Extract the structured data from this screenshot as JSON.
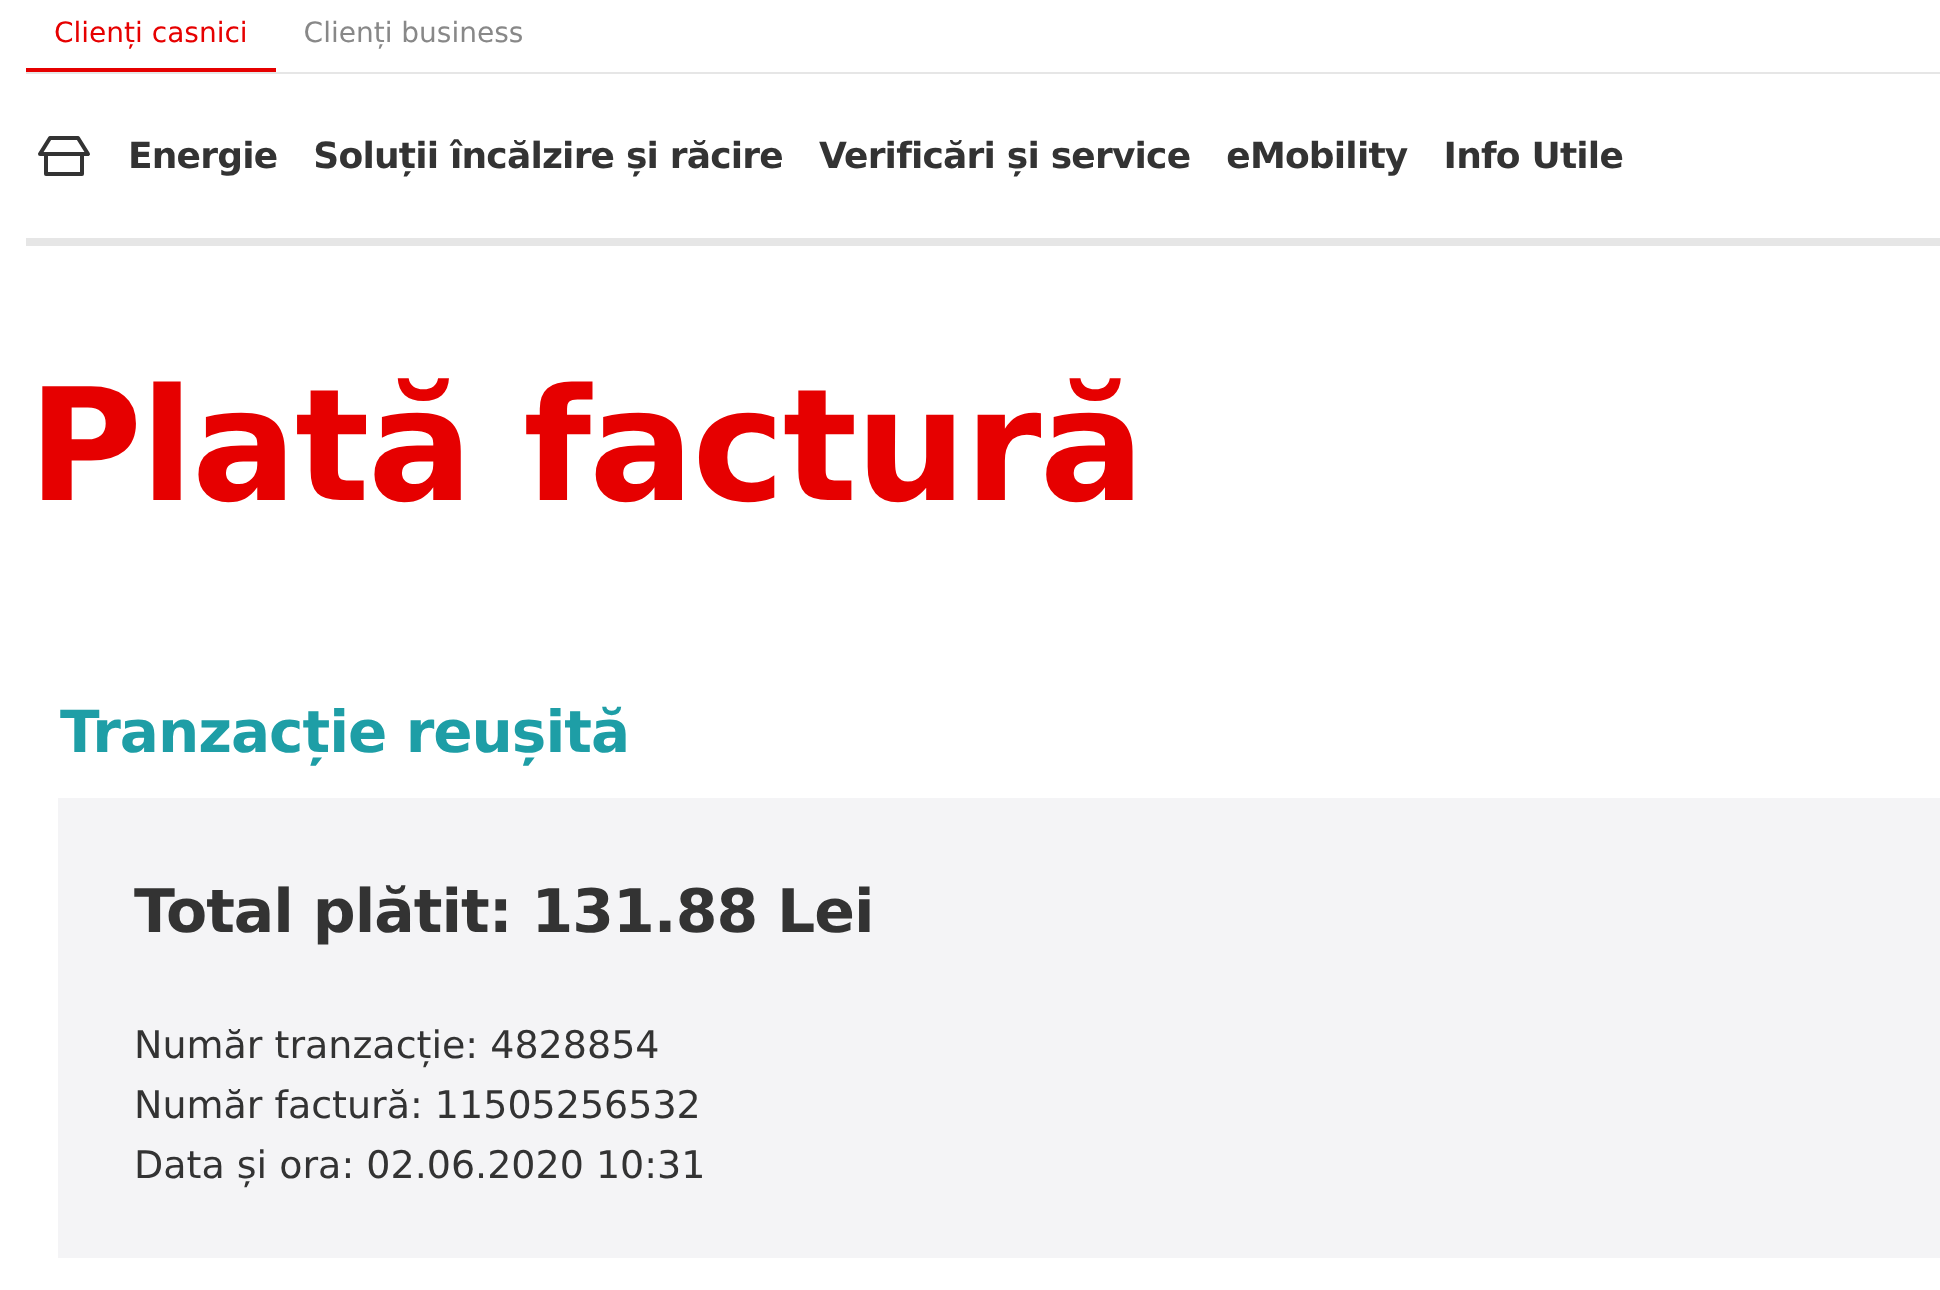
{
  "tabs": [
    {
      "label": "Clienți casnici",
      "selected": true
    },
    {
      "label": "Clienți business",
      "selected": false
    }
  ],
  "nav": {
    "items": [
      "Energie",
      "Soluții încălzire și răcire",
      "Verificări și service",
      "eMobility",
      "Info Utile"
    ]
  },
  "page_title": "Plată factură",
  "status": "Tranzacție reușită",
  "receipt": {
    "total": "Total plătit: 131.88 Lei",
    "details": [
      "Număr tranzacție: 4828854",
      "Număr factură: 11505256532",
      "Data și ora: 02.06.2020 10:31"
    ]
  }
}
